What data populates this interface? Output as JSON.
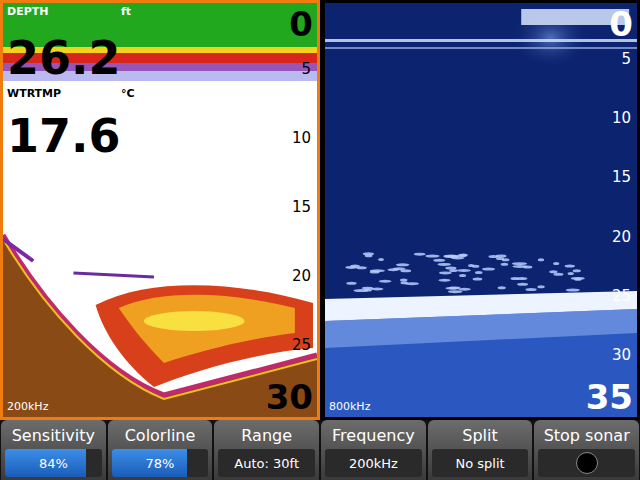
{
  "left_panel": {
    "depth_label": "DEPTH",
    "depth_unit": "ft",
    "depth": "26.2",
    "temp_label": "WTRTMP",
    "temp_unit": "°C",
    "temp": "17.6",
    "range_top": "0",
    "range_bottom": "30",
    "scale": [
      "5",
      "10",
      "15",
      "20",
      "25"
    ],
    "frequency": "200kHz",
    "selected": true
  },
  "right_panel": {
    "range_top": "0",
    "range_bottom": "35",
    "scale": [
      "5",
      "10",
      "15",
      "20",
      "25",
      "30"
    ],
    "frequency": "800kHz",
    "selected": false
  },
  "softkeys": [
    {
      "label": "Sensitivity",
      "value": "84%",
      "kind": "slider",
      "level": 0.84
    },
    {
      "label": "Colorline",
      "value": "78%",
      "kind": "slider",
      "level": 0.78
    },
    {
      "label": "Range",
      "value": "Auto: 30ft",
      "kind": "value"
    },
    {
      "label": "Frequency",
      "value": "200kHz",
      "kind": "value"
    },
    {
      "label": "Split",
      "value": "No split",
      "kind": "value"
    },
    {
      "label": "Stop sonar",
      "kind": "toggle",
      "on": false
    }
  ]
}
